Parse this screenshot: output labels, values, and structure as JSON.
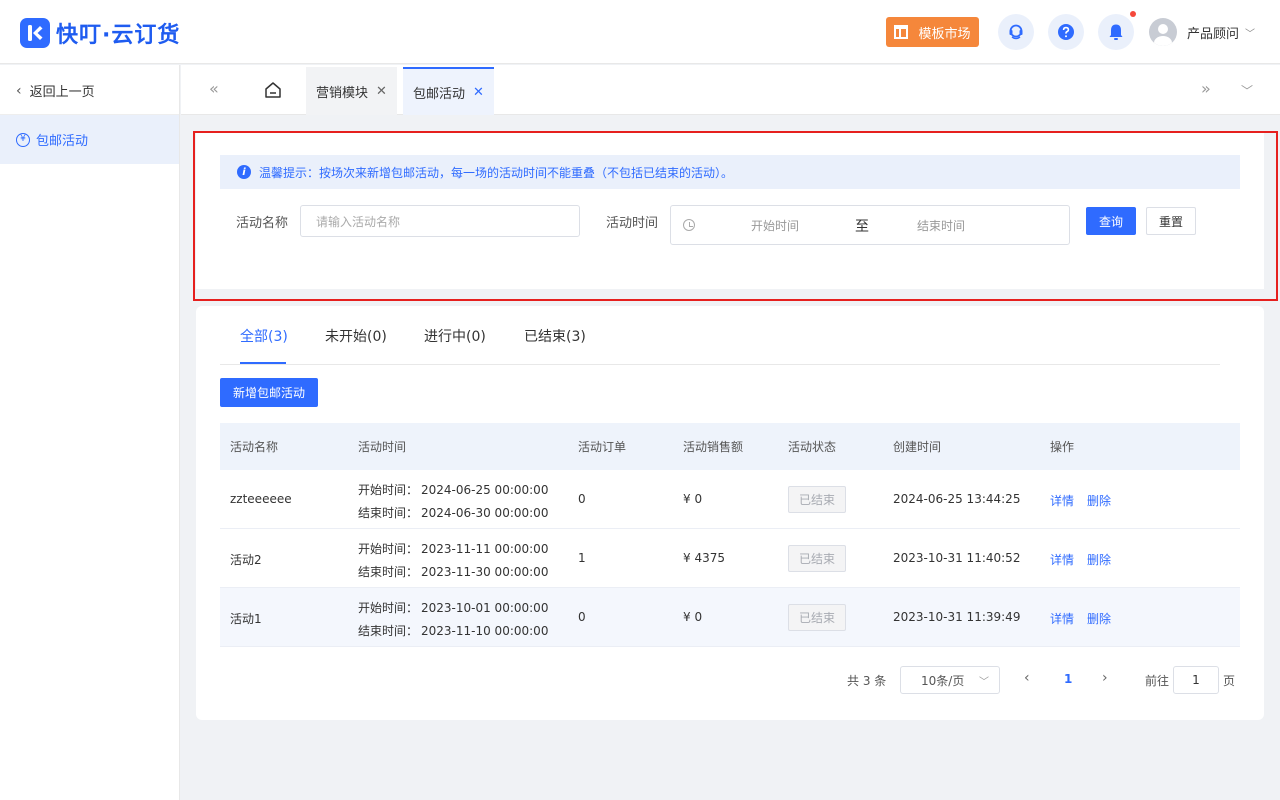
{
  "app": {
    "title": "快叮·云订货",
    "template_market": "模板市场",
    "user_name": "产品顾问",
    "accent": "#2f6bff"
  },
  "sidebar": {
    "back": "返回上一页",
    "items": [
      {
        "label": "包邮活动",
        "icon": "yen-icon"
      }
    ]
  },
  "tabs": [
    {
      "label": "营销模块"
    },
    {
      "label": "包邮活动"
    }
  ],
  "search": {
    "tip": "温馨提示：按场次来新增包邮活动，每一场的活动时间不能重叠（不包括已结束的活动）。",
    "name_label": "活动名称",
    "name_placeholder": "请输入活动名称",
    "time_label": "活动时间",
    "start_placeholder": "开始时间",
    "range_sep": "至",
    "end_placeholder": "结束时间",
    "query": "查询",
    "reset": "重置"
  },
  "status_tabs": [
    "全部(3)",
    "未开始(0)",
    "进行中(0)",
    "已结束(3)"
  ],
  "add_button": "新增包邮活动",
  "table": {
    "headers": [
      "活动名称",
      "活动时间",
      "活动订单",
      "活动销售额",
      "活动状态",
      "创建时间",
      "操作"
    ],
    "start_label": "开始时间：",
    "end_label": "结束时间：",
    "rows": [
      {
        "name": "zzteeeeee",
        "start": "2024-06-25 00:00:00",
        "end": "2024-06-30 00:00:00",
        "orders": "0",
        "sales": "¥ 0",
        "status": "已结束",
        "created": "2024-06-25 13:44:25",
        "detail": "详情",
        "delete": "删除"
      },
      {
        "name": "活动2",
        "start": "2023-11-11 00:00:00",
        "end": "2023-11-30 00:00:00",
        "orders": "1",
        "sales": "¥ 4375",
        "status": "已结束",
        "created": "2023-10-31 11:40:52",
        "detail": "详情",
        "delete": "删除"
      },
      {
        "name": "活动1",
        "start": "2023-10-01 00:00:00",
        "end": "2023-11-10 00:00:00",
        "orders": "0",
        "sales": "¥ 0",
        "status": "已结束",
        "created": "2023-10-31 11:39:49",
        "detail": "详情",
        "delete": "删除"
      }
    ]
  },
  "pagination": {
    "total": "共 3 条",
    "page_size": "10条/页",
    "current": "1",
    "goto_label": "前往",
    "goto_value": "1",
    "page_suffix": "页"
  }
}
